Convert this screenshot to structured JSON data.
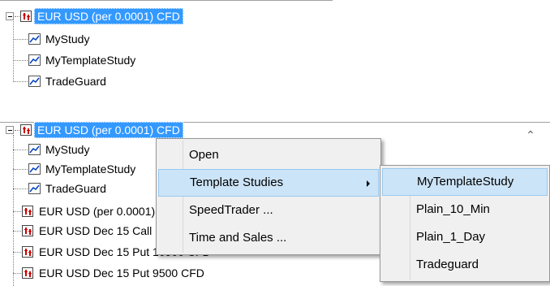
{
  "top_tree": {
    "root": {
      "label": "EUR USD (per 0.0001) CFD",
      "selected": true,
      "icon": "instrument-icon"
    },
    "children": [
      {
        "label": "MyStudy",
        "icon": "study-chart-icon"
      },
      {
        "label": "MyTemplateStudy",
        "icon": "study-chart-icon"
      },
      {
        "label": "TradeGuard",
        "icon": "study-chart-icon"
      }
    ]
  },
  "bottom_tree": {
    "root": {
      "label": "EUR USD (per 0.0001) CFD",
      "selected": true,
      "icon": "instrument-icon"
    },
    "study_children": [
      {
        "label": "MyStudy",
        "icon": "study-chart-icon"
      },
      {
        "label": "MyTemplateStudy",
        "icon": "study-chart-icon"
      },
      {
        "label": "TradeGuard",
        "icon": "study-chart-icon"
      }
    ],
    "instruments": [
      {
        "label": "EUR USD (per 0.0001) CFD",
        "icon": "instrument-icon"
      },
      {
        "label": "EUR USD Dec 15 Call 10900 CFD",
        "icon": "instrument-icon"
      },
      {
        "label": "EUR USD Dec 15 Put 10900 CFD",
        "icon": "instrument-icon"
      },
      {
        "label": "EUR USD Dec 15 Put 9500 CFD",
        "icon": "instrument-icon"
      }
    ],
    "scrollbar_icon": "chevron-up-icon"
  },
  "context_menu": {
    "items": [
      {
        "label": "Open",
        "highlighted": false,
        "has_submenu": false
      },
      {
        "label": "Template Studies",
        "highlighted": true,
        "has_submenu": true
      },
      {
        "label": "SpeedTrader ...",
        "highlighted": false,
        "has_submenu": false
      },
      {
        "label": "Time and Sales ...",
        "highlighted": false,
        "has_submenu": false
      }
    ]
  },
  "submenu": {
    "items": [
      {
        "label": "MyTemplateStudy",
        "highlighted": true
      },
      {
        "label": "Plain_10_Min",
        "highlighted": false
      },
      {
        "label": "Plain_1_Day",
        "highlighted": false
      },
      {
        "label": "Tradeguard",
        "highlighted": false
      }
    ]
  },
  "colors": {
    "selection": "#3399ff",
    "menu_background": "#f0f0f0",
    "menu_highlight": "#cce4f7",
    "instrument_bars": "#cc0000"
  }
}
